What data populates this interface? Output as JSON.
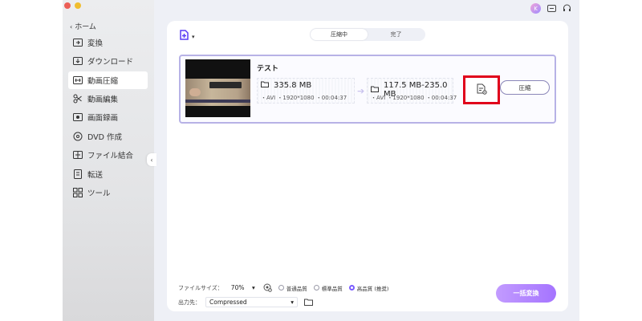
{
  "colors": {
    "accent": "#a574ff",
    "highlight": "#e0001b",
    "card_border": "#b7b2e6"
  },
  "sidebar": {
    "home_label": "ホーム",
    "items": [
      {
        "label": "変換",
        "icon": "convert-icon"
      },
      {
        "label": "ダウンロード",
        "icon": "download-icon"
      },
      {
        "label": "動画圧縮",
        "icon": "compress-icon",
        "active": true
      },
      {
        "label": "動画編集",
        "icon": "scissors-icon"
      },
      {
        "label": "画面録画",
        "icon": "screen-record-icon"
      },
      {
        "label": "DVD 作成",
        "icon": "dvd-icon"
      },
      {
        "label": "ファイル結合",
        "icon": "merge-icon"
      },
      {
        "label": "転送",
        "icon": "transfer-icon"
      },
      {
        "label": "ツール",
        "icon": "tools-icon"
      }
    ]
  },
  "header": {
    "avatar_letter": "K"
  },
  "tabs": [
    {
      "label": "圧縮中",
      "active": true
    },
    {
      "label": "完了",
      "active": false
    }
  ],
  "file": {
    "title": "テスト",
    "source": {
      "size": "335.8 MB",
      "meta": "・AVI ・1920*1080 ・00:04:37"
    },
    "output": {
      "size": "117.5 MB-235.0 MB",
      "meta": "・AVI ・1920*1080 ・00:04:37"
    },
    "compress_label": "圧縮"
  },
  "bottom": {
    "file_size_label": "ファイルサイズ：",
    "file_size_value": "70%",
    "quality_options": [
      {
        "label": "普通品質",
        "selected": false
      },
      {
        "label": "標準品質",
        "selected": false
      },
      {
        "label": "高品質 (推奨)",
        "selected": true
      }
    ],
    "output_label": "出力先：",
    "output_value": "Compressed",
    "batch_label": "一括変換"
  }
}
